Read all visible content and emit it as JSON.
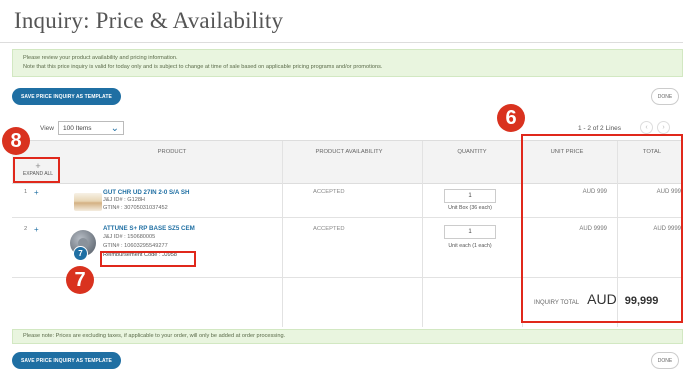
{
  "page": {
    "title": "Inquiry: Price & Availability"
  },
  "info": {
    "line1": "Please review your product availability and pricing information.",
    "line2": "Note that this price inquiry is valid for today only and is subject to change at time of sale based on applicable pricing programs and/or promotions."
  },
  "toolbar": {
    "save_template_label": "SAVE PRICE INQUIRY AS TEMPLATE",
    "done_label": "DONE"
  },
  "list": {
    "per_page_prefix": "View",
    "per_page_value": "100 Items",
    "pager_text": "1 - 2 of 2 Lines",
    "prev_icon": "chevron-left-icon",
    "next_icon": "chevron-right-icon"
  },
  "table": {
    "expand_all_label": "EXPAND ALL",
    "columns": {
      "product": "PRODUCT",
      "availability": "PRODUCT AVAILABILITY",
      "quantity": "QUANTITY",
      "unit_price": "UNIT PRICE",
      "total": "TOTAL"
    },
    "rows": [
      {
        "num": "1",
        "name": "GUT CHR UD 27IN 2-0 S/A SH",
        "jj_id": "J&J ID# : G128H",
        "gtin": "GTIN# : 30705031037452",
        "availability": "ACCEPTED",
        "quantity": "1",
        "unit": "Unit Box (36 each)",
        "unit_price": "AUD 999",
        "total": "AUD 999"
      },
      {
        "num": "2",
        "name": "ATTUNE S+ RP BASE SZ5 CEM",
        "jj_id": "J&J ID# : 150680005",
        "gtin": "GTIN# : 10603295549277",
        "reimbursement": "Reimbursement Code : JJ958",
        "availability": "ACCEPTED",
        "quantity": "1",
        "unit": "Unit each (1 each)",
        "unit_price": "AUD 9999",
        "total": "AUD 9999"
      }
    ]
  },
  "summary": {
    "label": "INQUIRY TOTAL",
    "currency": "AUD",
    "value": "99,999"
  },
  "tax_note": "Please note: Prices are excluding taxes, if applicable to your order, will only be added at order processing.",
  "callouts": {
    "c6": "6",
    "c7": "7",
    "c8": "8",
    "thumb_badge": "7"
  },
  "colors": {
    "accent": "#1f6fa3",
    "callout_red": "#d9321f",
    "banner_green": "#e9f5df"
  }
}
